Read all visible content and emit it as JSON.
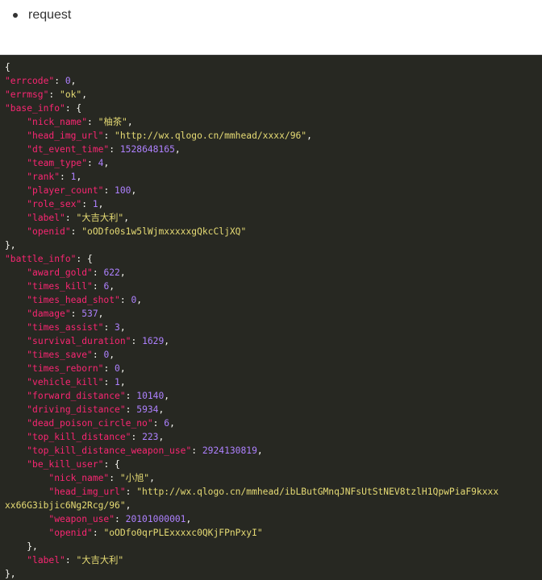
{
  "bullet": {
    "label": "request"
  },
  "code_block": {
    "lines": [
      [
        {
          "t": "p",
          "v": "{"
        }
      ],
      [
        {
          "t": "k",
          "v": "\"errcode\""
        },
        {
          "t": "p",
          "v": ": "
        },
        {
          "t": "n",
          "v": "0"
        },
        {
          "t": "p",
          "v": ","
        }
      ],
      [
        {
          "t": "k",
          "v": "\"errmsg\""
        },
        {
          "t": "p",
          "v": ": "
        },
        {
          "t": "s",
          "v": "\"ok\""
        },
        {
          "t": "p",
          "v": ","
        }
      ],
      [
        {
          "t": "k",
          "v": "\"base_info\""
        },
        {
          "t": "p",
          "v": ": {"
        }
      ],
      [
        {
          "t": "p",
          "v": "    "
        },
        {
          "t": "k",
          "v": "\"nick_name\""
        },
        {
          "t": "p",
          "v": ": "
        },
        {
          "t": "s",
          "v": "\"柚茶\""
        },
        {
          "t": "p",
          "v": ","
        }
      ],
      [
        {
          "t": "p",
          "v": "    "
        },
        {
          "t": "k",
          "v": "\"head_img_url\""
        },
        {
          "t": "p",
          "v": ": "
        },
        {
          "t": "s",
          "v": "\"http://wx.qlogo.cn/mmhead/xxxx/96\""
        },
        {
          "t": "p",
          "v": ","
        }
      ],
      [
        {
          "t": "p",
          "v": "    "
        },
        {
          "t": "k",
          "v": "\"dt_event_time\""
        },
        {
          "t": "p",
          "v": ": "
        },
        {
          "t": "n",
          "v": "1528648165"
        },
        {
          "t": "p",
          "v": ","
        }
      ],
      [
        {
          "t": "p",
          "v": "    "
        },
        {
          "t": "k",
          "v": "\"team_type\""
        },
        {
          "t": "p",
          "v": ": "
        },
        {
          "t": "n",
          "v": "4"
        },
        {
          "t": "p",
          "v": ","
        }
      ],
      [
        {
          "t": "p",
          "v": "    "
        },
        {
          "t": "k",
          "v": "\"rank\""
        },
        {
          "t": "p",
          "v": ": "
        },
        {
          "t": "n",
          "v": "1"
        },
        {
          "t": "p",
          "v": ","
        }
      ],
      [
        {
          "t": "p",
          "v": "    "
        },
        {
          "t": "k",
          "v": "\"player_count\""
        },
        {
          "t": "p",
          "v": ": "
        },
        {
          "t": "n",
          "v": "100"
        },
        {
          "t": "p",
          "v": ","
        }
      ],
      [
        {
          "t": "p",
          "v": "    "
        },
        {
          "t": "k",
          "v": "\"role_sex\""
        },
        {
          "t": "p",
          "v": ": "
        },
        {
          "t": "n",
          "v": "1"
        },
        {
          "t": "p",
          "v": ","
        }
      ],
      [
        {
          "t": "p",
          "v": "    "
        },
        {
          "t": "k",
          "v": "\"label\""
        },
        {
          "t": "p",
          "v": ": "
        },
        {
          "t": "s",
          "v": "\"大吉大利\""
        },
        {
          "t": "p",
          "v": ","
        }
      ],
      [
        {
          "t": "p",
          "v": "    "
        },
        {
          "t": "k",
          "v": "\"openid\""
        },
        {
          "t": "p",
          "v": ": "
        },
        {
          "t": "s",
          "v": "\"oODfo0s1w5lWjmxxxxxgQkcCljXQ\""
        }
      ],
      [
        {
          "t": "p",
          "v": "},"
        }
      ],
      [
        {
          "t": "k",
          "v": "\"battle_info\""
        },
        {
          "t": "p",
          "v": ": {"
        }
      ],
      [
        {
          "t": "p",
          "v": "    "
        },
        {
          "t": "k",
          "v": "\"award_gold\""
        },
        {
          "t": "p",
          "v": ": "
        },
        {
          "t": "n",
          "v": "622"
        },
        {
          "t": "p",
          "v": ","
        }
      ],
      [
        {
          "t": "p",
          "v": "    "
        },
        {
          "t": "k",
          "v": "\"times_kill\""
        },
        {
          "t": "p",
          "v": ": "
        },
        {
          "t": "n",
          "v": "6"
        },
        {
          "t": "p",
          "v": ","
        }
      ],
      [
        {
          "t": "p",
          "v": "    "
        },
        {
          "t": "k",
          "v": "\"times_head_shot\""
        },
        {
          "t": "p",
          "v": ": "
        },
        {
          "t": "n",
          "v": "0"
        },
        {
          "t": "p",
          "v": ","
        }
      ],
      [
        {
          "t": "p",
          "v": "    "
        },
        {
          "t": "k",
          "v": "\"damage\""
        },
        {
          "t": "p",
          "v": ": "
        },
        {
          "t": "n",
          "v": "537"
        },
        {
          "t": "p",
          "v": ","
        }
      ],
      [
        {
          "t": "p",
          "v": "    "
        },
        {
          "t": "k",
          "v": "\"times_assist\""
        },
        {
          "t": "p",
          "v": ": "
        },
        {
          "t": "n",
          "v": "3"
        },
        {
          "t": "p",
          "v": ","
        }
      ],
      [
        {
          "t": "p",
          "v": "    "
        },
        {
          "t": "k",
          "v": "\"survival_duration\""
        },
        {
          "t": "p",
          "v": ": "
        },
        {
          "t": "n",
          "v": "1629"
        },
        {
          "t": "p",
          "v": ","
        }
      ],
      [
        {
          "t": "p",
          "v": "    "
        },
        {
          "t": "k",
          "v": "\"times_save\""
        },
        {
          "t": "p",
          "v": ": "
        },
        {
          "t": "n",
          "v": "0"
        },
        {
          "t": "p",
          "v": ","
        }
      ],
      [
        {
          "t": "p",
          "v": "    "
        },
        {
          "t": "k",
          "v": "\"times_reborn\""
        },
        {
          "t": "p",
          "v": ": "
        },
        {
          "t": "n",
          "v": "0"
        },
        {
          "t": "p",
          "v": ","
        }
      ],
      [
        {
          "t": "p",
          "v": "    "
        },
        {
          "t": "k",
          "v": "\"vehicle_kill\""
        },
        {
          "t": "p",
          "v": ": "
        },
        {
          "t": "n",
          "v": "1"
        },
        {
          "t": "p",
          "v": ","
        }
      ],
      [
        {
          "t": "p",
          "v": "    "
        },
        {
          "t": "k",
          "v": "\"forward_distance\""
        },
        {
          "t": "p",
          "v": ": "
        },
        {
          "t": "n",
          "v": "10140"
        },
        {
          "t": "p",
          "v": ","
        }
      ],
      [
        {
          "t": "p",
          "v": "    "
        },
        {
          "t": "k",
          "v": "\"driving_distance\""
        },
        {
          "t": "p",
          "v": ": "
        },
        {
          "t": "n",
          "v": "5934"
        },
        {
          "t": "p",
          "v": ","
        }
      ],
      [
        {
          "t": "p",
          "v": "    "
        },
        {
          "t": "k",
          "v": "\"dead_poison_circle_no\""
        },
        {
          "t": "p",
          "v": ": "
        },
        {
          "t": "n",
          "v": "6"
        },
        {
          "t": "p",
          "v": ","
        }
      ],
      [
        {
          "t": "p",
          "v": "    "
        },
        {
          "t": "k",
          "v": "\"top_kill_distance\""
        },
        {
          "t": "p",
          "v": ": "
        },
        {
          "t": "n",
          "v": "223"
        },
        {
          "t": "p",
          "v": ","
        }
      ],
      [
        {
          "t": "p",
          "v": "    "
        },
        {
          "t": "k",
          "v": "\"top_kill_distance_weapon_use\""
        },
        {
          "t": "p",
          "v": ": "
        },
        {
          "t": "n",
          "v": "2924130819"
        },
        {
          "t": "p",
          "v": ","
        }
      ],
      [
        {
          "t": "p",
          "v": "    "
        },
        {
          "t": "k",
          "v": "\"be_kill_user\""
        },
        {
          "t": "p",
          "v": ": {"
        }
      ],
      [
        {
          "t": "p",
          "v": "        "
        },
        {
          "t": "k",
          "v": "\"nick_name\""
        },
        {
          "t": "p",
          "v": ": "
        },
        {
          "t": "s",
          "v": "\"小旭\""
        },
        {
          "t": "p",
          "v": ","
        }
      ],
      [
        {
          "t": "p",
          "v": "        "
        },
        {
          "t": "k",
          "v": "\"head_img_url\""
        },
        {
          "t": "p",
          "v": ": "
        },
        {
          "t": "s",
          "v": "\"http://wx.qlogo.cn/mmhead/ibLButGMnqJNFsUtStNEV8tzlH1QpwPiaF9kxxx"
        }
      ],
      [
        {
          "t": "s",
          "v": "xx66G3ibjic6Ng2Rcg/96\""
        },
        {
          "t": "p",
          "v": ","
        }
      ],
      [
        {
          "t": "p",
          "v": "        "
        },
        {
          "t": "k",
          "v": "\"weapon_use\""
        },
        {
          "t": "p",
          "v": ": "
        },
        {
          "t": "n",
          "v": "20101000001"
        },
        {
          "t": "p",
          "v": ","
        }
      ],
      [
        {
          "t": "p",
          "v": "        "
        },
        {
          "t": "k",
          "v": "\"openid\""
        },
        {
          "t": "p",
          "v": ": "
        },
        {
          "t": "s",
          "v": "\"oODfo0qrPLExxxxc0QKjFPnPxyI\""
        }
      ],
      [
        {
          "t": "p",
          "v": "    },"
        }
      ],
      [
        {
          "t": "p",
          "v": "    "
        },
        {
          "t": "k",
          "v": "\"label\""
        },
        {
          "t": "p",
          "v": ": "
        },
        {
          "t": "s",
          "v": "\"大吉大利\""
        }
      ],
      [
        {
          "t": "p",
          "v": "},"
        }
      ]
    ]
  },
  "colors": {
    "code_background": "#272822",
    "key": "#f92672",
    "string": "#e6db74",
    "number": "#ae81ff",
    "punctuation": "#f8f8f2"
  }
}
